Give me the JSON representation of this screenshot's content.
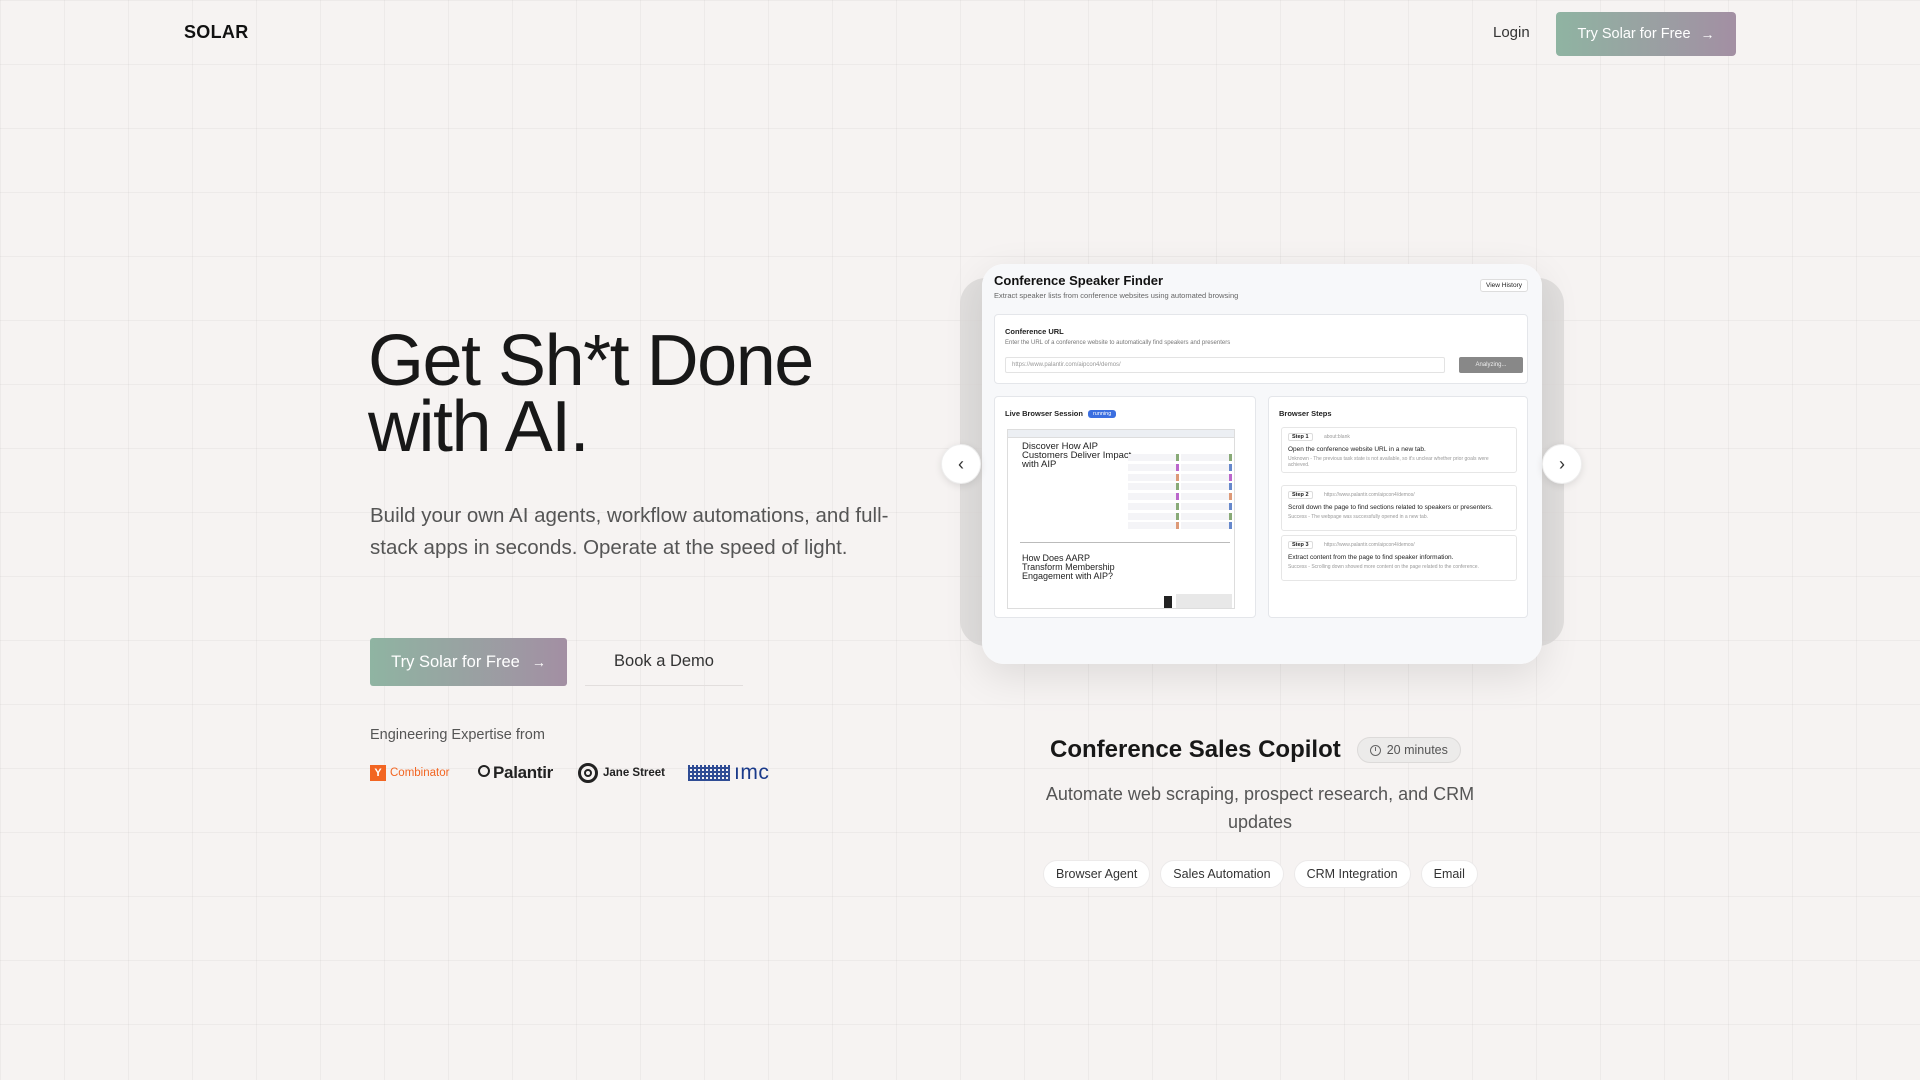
{
  "nav": {
    "logo": "SOLAR",
    "login": "Login",
    "cta": "Try Solar for Free",
    "cta_arrow": "→"
  },
  "hero": {
    "title_line1": "Get Sh*t Done",
    "title_line2": "with AI.",
    "subtitle": "Build your own AI agents, workflow automations, and full-stack apps in seconds. Operate at the speed of light.",
    "cta_primary": "Try Solar for Free",
    "cta_primary_arrow": "→",
    "cta_secondary": "Book a Demo",
    "expertise_label": "Engineering Expertise from",
    "logos": {
      "yc_mark": "Y",
      "yc": "Combinator",
      "palantir": "Palantir",
      "janestreet": "Jane Street",
      "imc": "ımc"
    }
  },
  "carousel": {
    "prev": "‹",
    "next": "›",
    "screenshot": {
      "title": "Conference Speaker Finder",
      "subtitle": "Extract speaker lists from conference websites using automated browsing",
      "history_button": "View History",
      "url_section_title": "Conference URL",
      "url_section_desc": "Enter the URL of a conference website to automatically find speakers and presenters",
      "url_placeholder": "https://www.palantir.com/aipcon4/demos/",
      "analyze_button": "Analyzing...",
      "live_title": "Live Browser Session",
      "live_badge": "running",
      "page_heading": "Discover How AIP Customers Deliver Impact with AIP",
      "page_heading2": "How Does AARP Transform Membership Engagement with AIP?",
      "steps_title": "Browser Steps",
      "steps": [
        {
          "tag": "Step 1",
          "url": "about:blank",
          "task": "Open the conference website URL in a new tab.",
          "status": "Unknown - The previous task state is not available, so it's unclear whether prior goals were achieved."
        },
        {
          "tag": "Step 2",
          "url": "https://www.palantir.com/aipcon4/demos/",
          "task": "Scroll down the page to find sections related to speakers or presenters.",
          "status": "Success - The webpage was successfully opened in a new tab."
        },
        {
          "tag": "Step 3",
          "url": "https://www.palantir.com/aipcon4/demos/",
          "task": "Extract content from the page to find speaker information.",
          "status": "Success - Scrolling down showed more content on the page related to the conference."
        }
      ]
    },
    "slide": {
      "title": "Conference Sales Copilot",
      "duration": "20 minutes",
      "description": "Automate web scraping, prospect research, and CRM updates",
      "tags": [
        "Browser Agent",
        "Sales Automation",
        "CRM Integration",
        "Email"
      ]
    }
  },
  "colors": {
    "background": "#f6f3f2",
    "cta_gradient_start": "#8fb4a2",
    "cta_gradient_end": "#a38fa3",
    "yc_orange": "#f26522",
    "imc_blue": "#1a3a8a"
  }
}
